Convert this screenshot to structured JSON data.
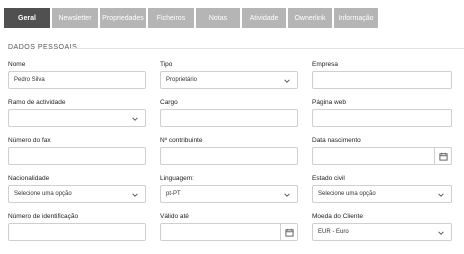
{
  "tabs": [
    {
      "label": "Geral",
      "active": true
    },
    {
      "label": "Newsletter"
    },
    {
      "label": "Propriedades"
    },
    {
      "label": "Ficheiros"
    },
    {
      "label": "Notas"
    },
    {
      "label": "Atividade"
    },
    {
      "label": "Ownerlink"
    },
    {
      "label": "Informação"
    }
  ],
  "section": {
    "title": "DADOS PESSOAIS"
  },
  "form": {
    "nome": {
      "label": "Nome",
      "value": "Pedro Silva"
    },
    "tipo": {
      "label": "Tipo",
      "value": "Proprietário"
    },
    "empresa": {
      "label": "Empresa",
      "value": ""
    },
    "ramo": {
      "label": "Ramo de actividade",
      "value": ""
    },
    "cargo": {
      "label": "Cargo",
      "value": ""
    },
    "pagina_web": {
      "label": "Página web",
      "value": ""
    },
    "fax": {
      "label": "Número do fax",
      "value": ""
    },
    "contribuinte": {
      "label": "Nº contribuinte",
      "value": ""
    },
    "data_nascimento": {
      "label": "Data nascimento",
      "value": ""
    },
    "nacionalidade": {
      "label": "Nacionalidade",
      "value": "Selecione uma opção"
    },
    "linguagem": {
      "label": "Linguagem:",
      "value": "pt-PT"
    },
    "estado_civil": {
      "label": "Estado civil",
      "value": "Selecione uma opção"
    },
    "identificacao": {
      "label": "Número de identificação",
      "value": ""
    },
    "valido_ate": {
      "label": "Válido até",
      "value": ""
    },
    "moeda": {
      "label": "Moeda do Cliente",
      "value": "EUR - Euro"
    }
  },
  "bottom_hint": ""
}
